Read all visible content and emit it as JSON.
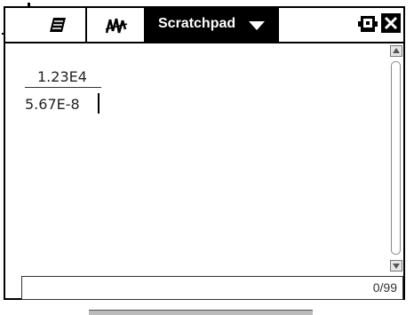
{
  "tabs": [
    {
      "name": "calculator",
      "icon": "calculator-icon"
    },
    {
      "name": "graphs",
      "icon": "graph-icon"
    }
  ],
  "scratchpad": {
    "title": "Scratchpad"
  },
  "icons": {
    "window": "doc-window-icon",
    "close": "close-icon"
  },
  "expression": {
    "numerator": "1.23E4",
    "denominator": "5.67E-8"
  },
  "status": {
    "history_count": "0/99"
  },
  "colors": {
    "active_tab_bg": "#000000",
    "frame": "#000000"
  }
}
